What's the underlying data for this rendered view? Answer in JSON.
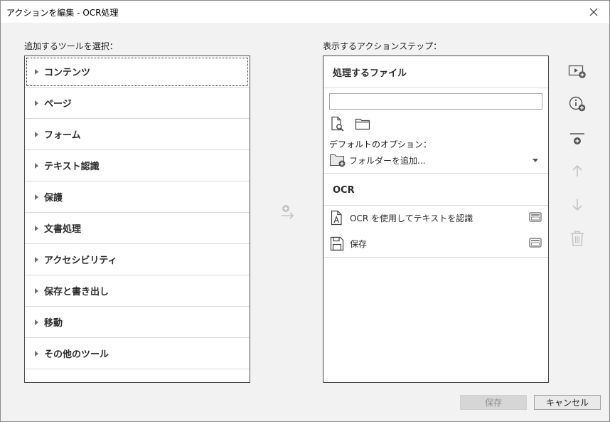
{
  "window": {
    "title": "アクションを編集 - OCR処理"
  },
  "tools_panel": {
    "label": "追加するツールを選択：",
    "items": [
      {
        "label": "コンテンツ"
      },
      {
        "label": "ページ"
      },
      {
        "label": "フォーム"
      },
      {
        "label": "テキスト認識"
      },
      {
        "label": "保護"
      },
      {
        "label": "文書処理"
      },
      {
        "label": "アクセシビリティ"
      },
      {
        "label": "保存と書き出し"
      },
      {
        "label": "移動"
      },
      {
        "label": "その他のツール"
      }
    ]
  },
  "steps_panel": {
    "label": "表示するアクションステップ：",
    "files_heading": "処理するファイル",
    "file_input": {
      "value": "",
      "placeholder": ""
    },
    "default_options_label": "デフォルトのオプション：",
    "add_folder_label": "フォルダーを追加...",
    "ocr_heading": "OCR",
    "steps": [
      {
        "label": "OCR を使用してテキストを認識",
        "icon": "ocr-document-icon"
      },
      {
        "label": "保存",
        "icon": "save-floppy-icon"
      }
    ]
  },
  "side_tools": {
    "icons": [
      "add-media-icon",
      "add-instruction-icon",
      "add-divider-icon",
      "move-up-icon",
      "move-down-icon",
      "delete-icon"
    ]
  },
  "buttons": {
    "save_label": "保存",
    "cancel_label": "キャンセル"
  },
  "colors": {
    "background": "#f2f2f2",
    "panel_border": "#4a4a4a",
    "disabled_icon": "#c4c4c4",
    "active_icon": "#6e6e6e"
  }
}
